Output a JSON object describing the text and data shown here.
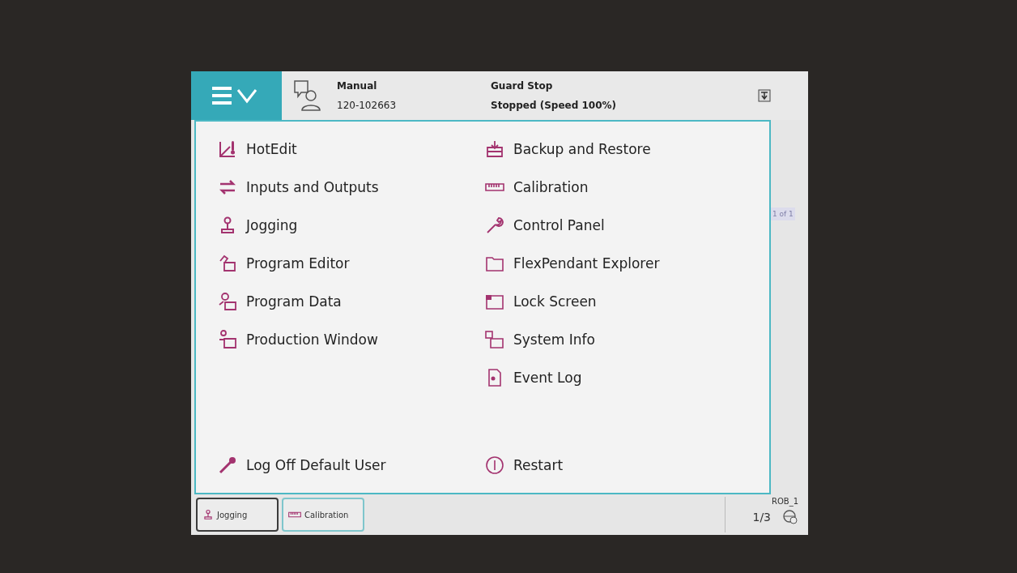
{
  "header": {
    "mode": "Manual",
    "system_id": "120-102663",
    "state": "Guard Stop",
    "run_status": "Stopped (Speed 100%)"
  },
  "menu": {
    "left": [
      {
        "label": "HotEdit"
      },
      {
        "label": "Inputs and Outputs"
      },
      {
        "label": "Jogging"
      },
      {
        "label": "Program Editor"
      },
      {
        "label": "Program Data"
      },
      {
        "label": "Production Window"
      }
    ],
    "right": [
      {
        "label": "Backup and Restore"
      },
      {
        "label": "Calibration"
      },
      {
        "label": "Control Panel"
      },
      {
        "label": "FlexPendant Explorer"
      },
      {
        "label": "Lock Screen"
      },
      {
        "label": "System Info"
      },
      {
        "label": "Event Log"
      }
    ],
    "log_off": "Log Off Default User",
    "restart": "Restart"
  },
  "background_window": {
    "page_indicator": "1 of 1"
  },
  "taskbar": {
    "tabs": [
      {
        "label": "Jogging",
        "selected": true
      },
      {
        "label": "Calibration",
        "selected": false
      }
    ],
    "unit": "ROB_1",
    "task_fraction": "1/3"
  }
}
